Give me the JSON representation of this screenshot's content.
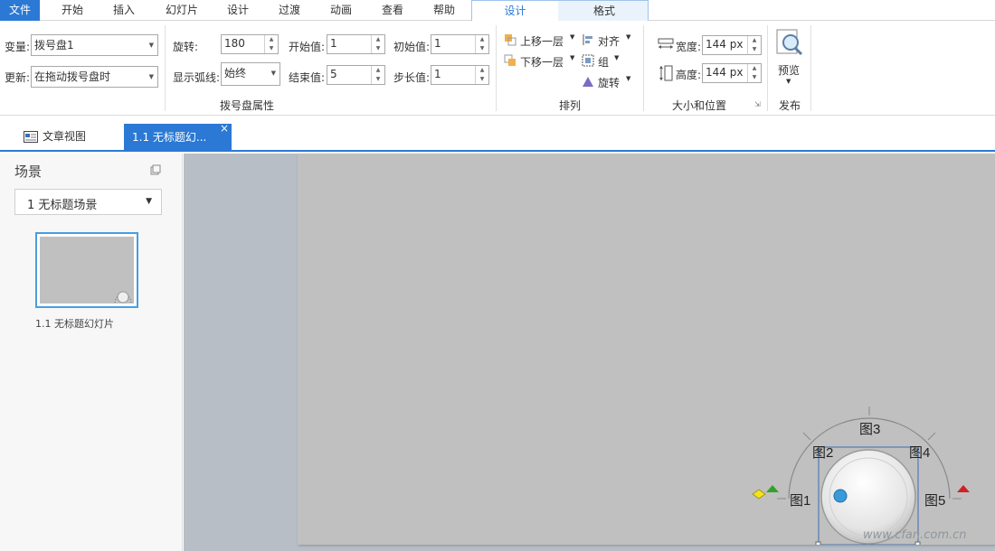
{
  "menu": {
    "items": [
      "文件",
      "开始",
      "插入",
      "幻灯片",
      "设计",
      "过渡",
      "动画",
      "查看",
      "帮助"
    ],
    "context_tabs": [
      "设计",
      "格式"
    ]
  },
  "ribbon": {
    "dial_props": {
      "variable_label": "变量:",
      "variable_value": "拨号盘1",
      "update_label": "更新:",
      "update_value": "在拖动拨号盘时",
      "rotation_label": "旋转:",
      "rotation_value": "180",
      "arc_label": "显示弧线:",
      "arc_value": "始终",
      "start_label": "开始值:",
      "start_value": "1",
      "end_label": "结束值:",
      "end_value": "5",
      "initial_label": "初始值:",
      "initial_value": "1",
      "step_label": "步长值:",
      "step_value": "1",
      "group_label": "拨号盘属性"
    },
    "arrange": {
      "bring_forward": "上移一层",
      "send_backward": "下移一层",
      "align": "对齐",
      "group": "组",
      "rotate": "旋转",
      "group_label": "排列"
    },
    "size": {
      "width_label": "宽度:",
      "width_value": "144 px",
      "height_label": "高度:",
      "height_value": "144 px",
      "group_label": "大小和位置"
    },
    "publish": {
      "preview": "预览",
      "group_label": "发布"
    }
  },
  "tabs": {
    "story_view": "文章视图",
    "slide_tab": "1.1 无标题幻...",
    "close": "×"
  },
  "scenes": {
    "title": "场景",
    "selected": "1 无标题场景",
    "thumb_label": "1.1 无标题幻灯片"
  },
  "dial": {
    "labels": [
      "图1",
      "图2",
      "图3",
      "图4",
      "图5"
    ]
  },
  "watermark": "www.cfan.com.cn"
}
